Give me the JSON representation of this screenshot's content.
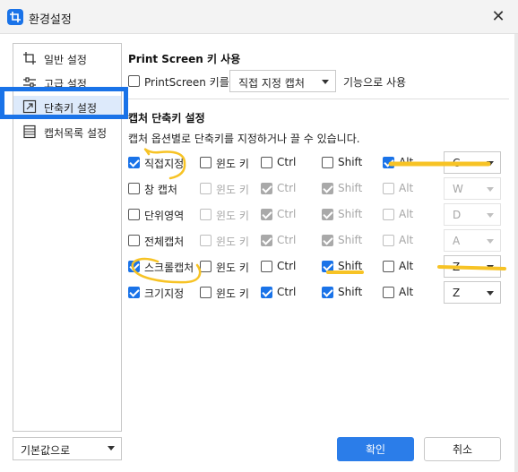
{
  "window": {
    "title": "환경설정",
    "close_label": "✕"
  },
  "sidebar": {
    "items": [
      {
        "label": "일반 설정",
        "icon": "crop-icon"
      },
      {
        "label": "고급 설정",
        "icon": "sliders-icon"
      },
      {
        "label": "단축키 설정",
        "icon": "shortcut-icon",
        "active": true
      },
      {
        "label": "캡처목록 설정",
        "icon": "list-icon"
      }
    ],
    "default_select": "기본값으로"
  },
  "print_screen": {
    "title": "Print Screen 키 사용",
    "checkbox_label": "PrintScreen 키를",
    "checked": false,
    "mode": "직접 지정 캡처",
    "suffix": "기능으로 사용"
  },
  "shortcuts": {
    "title": "캡처 단축키 설정",
    "description": "캡처 옵션별로 단축키를 지정하거나 끌 수 있습니다.",
    "modifier_labels": {
      "win": "윈도 키",
      "ctrl": "Ctrl",
      "shift": "Shift",
      "alt": "Alt"
    },
    "rows": [
      {
        "name": "직접지정",
        "enabled": true,
        "win": false,
        "ctrl": false,
        "shift": false,
        "alt": true,
        "key": "C"
      },
      {
        "name": "창 캡처",
        "enabled": false,
        "win": false,
        "ctrl": true,
        "shift": true,
        "alt": false,
        "key": "W"
      },
      {
        "name": "단위영역",
        "enabled": false,
        "win": false,
        "ctrl": true,
        "shift": true,
        "alt": false,
        "key": "D"
      },
      {
        "name": "전체캡처",
        "enabled": false,
        "win": false,
        "ctrl": true,
        "shift": true,
        "alt": false,
        "key": "A"
      },
      {
        "name": "스크롤캡처",
        "enabled": true,
        "win": false,
        "ctrl": false,
        "shift": true,
        "alt": false,
        "key": "Z"
      },
      {
        "name": "크기지정",
        "enabled": true,
        "win": false,
        "ctrl": true,
        "shift": true,
        "alt": false,
        "key": "Z"
      }
    ]
  },
  "buttons": {
    "ok": "확인",
    "cancel": "취소"
  },
  "colors": {
    "accent": "#1a73e8",
    "highlighter": "#f7c325",
    "primary_button": "#2b7de9"
  }
}
